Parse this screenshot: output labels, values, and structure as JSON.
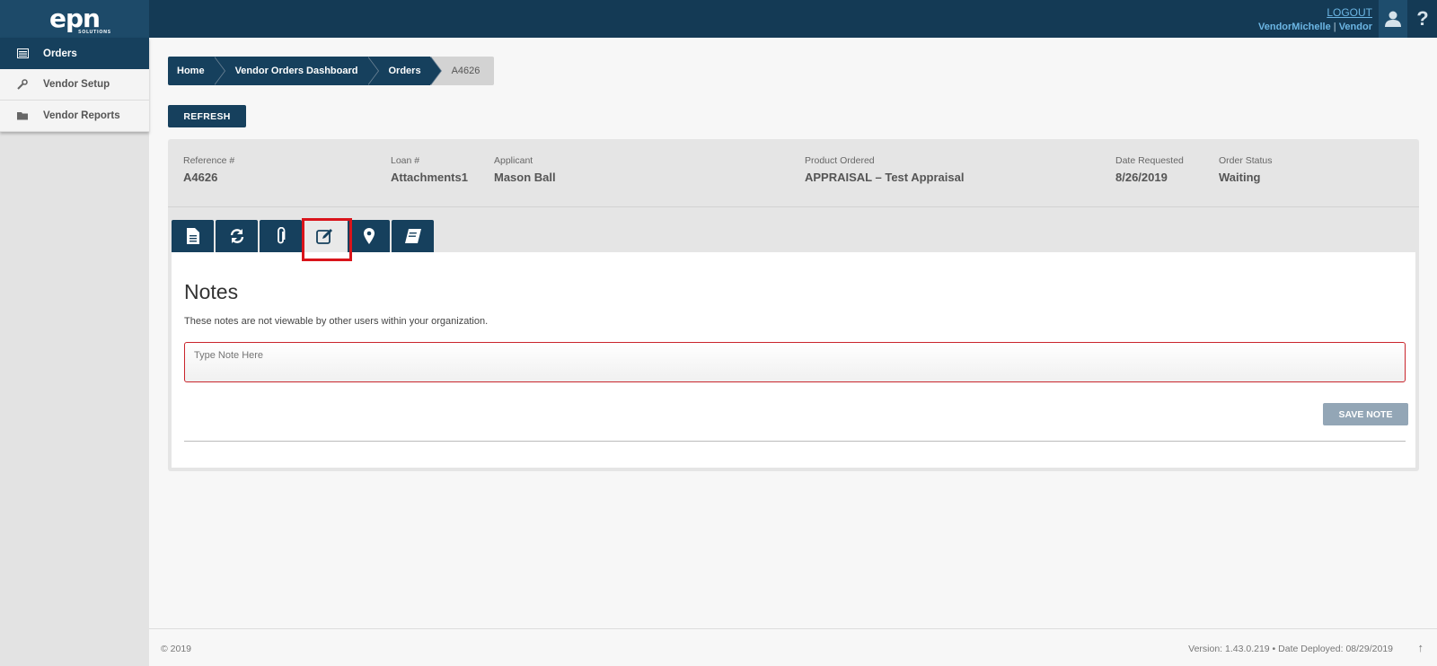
{
  "header": {
    "logo_text": "epn",
    "logo_subtext": "SOLUTIONS",
    "logout_label": "LOGOUT",
    "user_name": "VendorMichelle",
    "user_separator": "|",
    "user_role": "Vendor",
    "help_label": "?"
  },
  "sidebar": {
    "items": [
      {
        "label": "Orders",
        "icon": "list-icon",
        "active": true
      },
      {
        "label": "Vendor Setup",
        "icon": "wrench-icon",
        "active": false
      },
      {
        "label": "Vendor Reports",
        "icon": "folder-icon",
        "active": false
      }
    ]
  },
  "breadcrumb": [
    "Home",
    "Vendor Orders Dashboard",
    "Orders",
    "A4626"
  ],
  "refresh_label": "REFRESH",
  "order": {
    "reference_label": "Reference #",
    "reference_value": "A4626",
    "loan_label": "Loan #",
    "loan_value": "Attachments1",
    "applicant_label": "Applicant",
    "applicant_value": "Mason Ball",
    "product_label": "Product Ordered",
    "product_value": "APPRAISAL – Test Appraisal",
    "date_label": "Date Requested",
    "date_value": "8/26/2019",
    "status_label": "Order Status",
    "status_value": "Waiting"
  },
  "tabs": [
    {
      "icon": "document-icon",
      "active": false
    },
    {
      "icon": "refresh-icon",
      "active": false
    },
    {
      "icon": "paperclip-icon",
      "active": false
    },
    {
      "icon": "edit-note-icon",
      "active": true
    },
    {
      "icon": "map-marker-icon",
      "active": false
    },
    {
      "icon": "book-icon",
      "active": false
    }
  ],
  "notes": {
    "title": "Notes",
    "description": "These notes are not viewable by other users within your organization.",
    "placeholder": "Type Note Here",
    "save_label": "SAVE NOTE"
  },
  "footer": {
    "copyright": "© 2019",
    "version": "Version: 1.43.0.219  •  Date Deployed: 08/29/2019",
    "scroll_top": "↑"
  },
  "colors": {
    "primary": "#16405d",
    "highlight": "#d9141b",
    "link": "#6cb6e4"
  }
}
